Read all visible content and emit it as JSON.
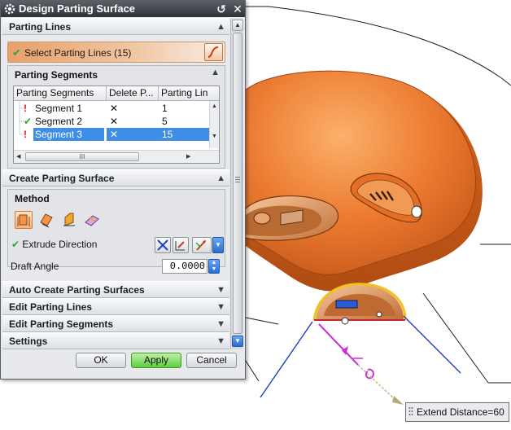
{
  "dialog": {
    "title": "Design Parting Surface",
    "sections": {
      "parting_lines": "Parting Lines",
      "create_parting_surface": "Create Parting Surface",
      "auto_create": "Auto Create Parting Surfaces",
      "edit_parting_lines": "Edit Parting Lines",
      "edit_parting_segments": "Edit Parting Segments",
      "settings": "Settings"
    },
    "select_parting_lines": "Select Parting Lines (15)",
    "parting_segments": {
      "title": "Parting Segments",
      "columns": [
        "Parting Segments",
        "Delete P...",
        "Parting Lin"
      ],
      "rows": [
        {
          "name": "Segment 1",
          "status": "error",
          "delete": "✕",
          "parting_line": "1",
          "selected": false
        },
        {
          "name": "Segment 2",
          "status": "ok",
          "delete": "✕",
          "parting_line": "5",
          "selected": false
        },
        {
          "name": "Segment 3",
          "status": "error",
          "delete": "✕",
          "parting_line": "15",
          "selected": true
        }
      ],
      "hscroll_grip": "III"
    },
    "method": {
      "title": "Method",
      "icons": [
        "extrude-method-icon",
        "sweep-method-icon",
        "extend-method-icon",
        "bounded-plane-method-icon"
      ],
      "active_index": 0
    },
    "extrude_direction_label": "Extrude Direction",
    "draft_angle_label": "Draft Angle",
    "draft_angle_value": "0.0000",
    "buttons": {
      "ok": "OK",
      "apply": "Apply",
      "cancel": "Cancel"
    }
  },
  "status": {
    "extend_distance": "Extend Distance=60"
  },
  "colors": {
    "part_orange": "#e9782e",
    "accent_blue": "#3d8ee8",
    "ok_green": "#2fa536",
    "error_red": "#d21c1c",
    "apply_green": "#5fcd3d"
  }
}
